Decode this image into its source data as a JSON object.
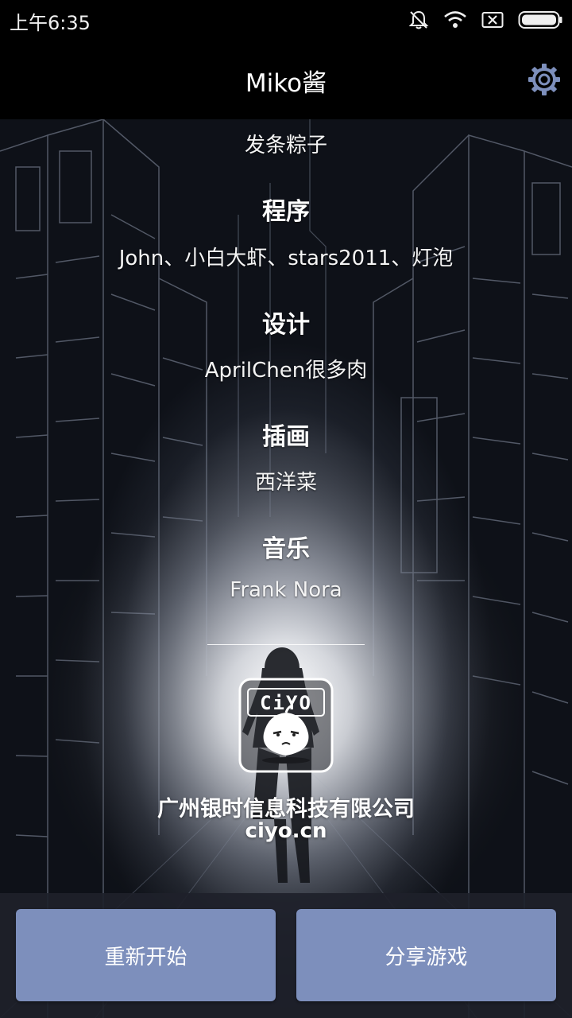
{
  "status_bar": {
    "time": "上午6:35",
    "icons": [
      "bell-muted-icon",
      "wifi-icon",
      "sim-x-icon",
      "battery-icon"
    ]
  },
  "title_bar": {
    "title": "Miko酱",
    "settings_icon": "gear-icon",
    "accent_color": "#7d8fbc"
  },
  "credits": {
    "intro_line": "发条粽子",
    "sections": [
      {
        "heading": "程序",
        "names": "John、小白大虾、stars2011、灯泡"
      },
      {
        "heading": "设计",
        "names": "AprilChen很多肉"
      },
      {
        "heading": "插画",
        "names": "西洋菜"
      },
      {
        "heading": "音乐",
        "names": "Frank Nora"
      }
    ]
  },
  "company": {
    "logo_text": "CiYO",
    "name": "广州银时信息科技有限公司",
    "url": "ciyo.cn"
  },
  "buttons": {
    "restart": "重新开始",
    "share": "分享游戏",
    "color": "#7d8fbc"
  }
}
